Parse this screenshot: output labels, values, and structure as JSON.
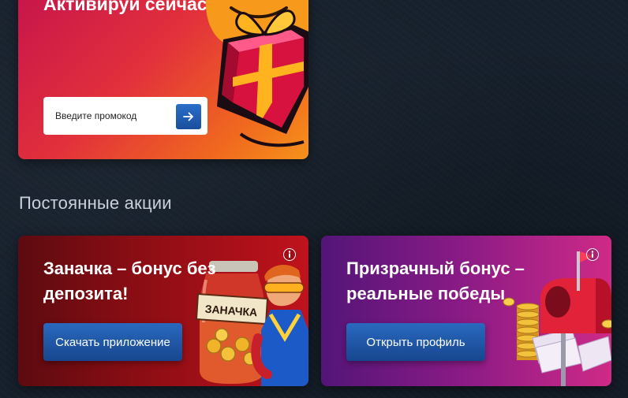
{
  "promo": {
    "title": "Активируй сейчас!",
    "input_placeholder": "Введите промокод",
    "submit_icon": "arrow-right-icon"
  },
  "section": {
    "title": "Постоянные акции"
  },
  "offers": [
    {
      "title": "Заначка – бонус без депозита!",
      "button_label": "Скачать приложение",
      "art_label": "ЗАНАЧКА",
      "info_icon": "info-icon",
      "color": "#a10f18"
    },
    {
      "title": "Призрачный бонус – реальные победы",
      "button_label": "Открыть профиль",
      "info_icon": "info-icon",
      "color": "#9a1f8a"
    }
  ],
  "colors": {
    "background": "#16202c",
    "button": "#1f5aad",
    "promo_accent": "#e2303c"
  }
}
